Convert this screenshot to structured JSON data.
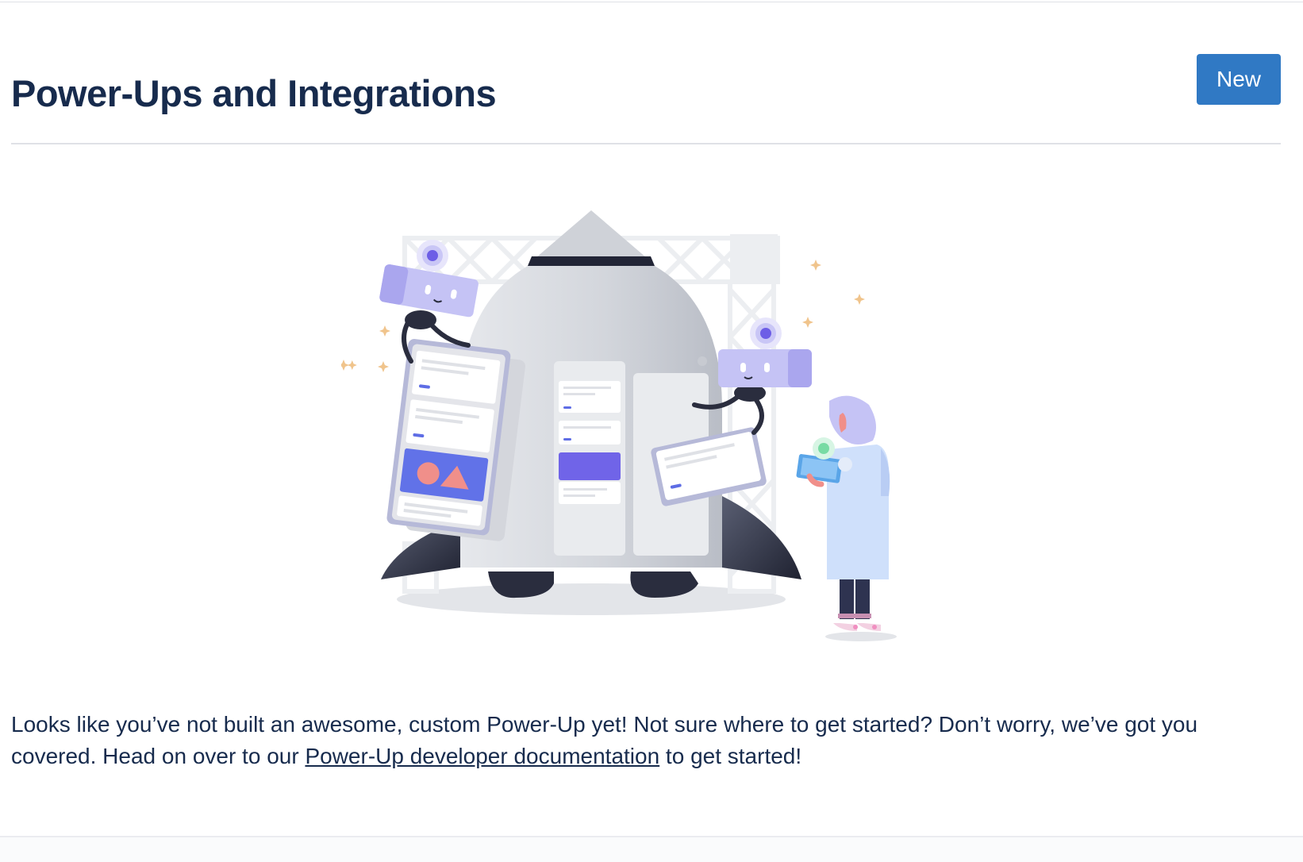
{
  "header": {
    "title": "Power-Ups and Integrations",
    "new_button_label": "New"
  },
  "empty_state": {
    "illustration": "rocket-launch-illustration",
    "message_before_link": "Looks like you’ve not built an awesome, custom Power-Up yet! Not sure where to get started? Don’t worry, we’ve got you covered. Head on over to our ",
    "link_text": "Power-Up developer documentation",
    "message_after_link": " to get started!"
  },
  "colors": {
    "brand_blue": "#3079c4",
    "text_dark": "#172b4d",
    "accent_purple": "#7b68ee",
    "robot_lavender": "#c5c3f5"
  }
}
